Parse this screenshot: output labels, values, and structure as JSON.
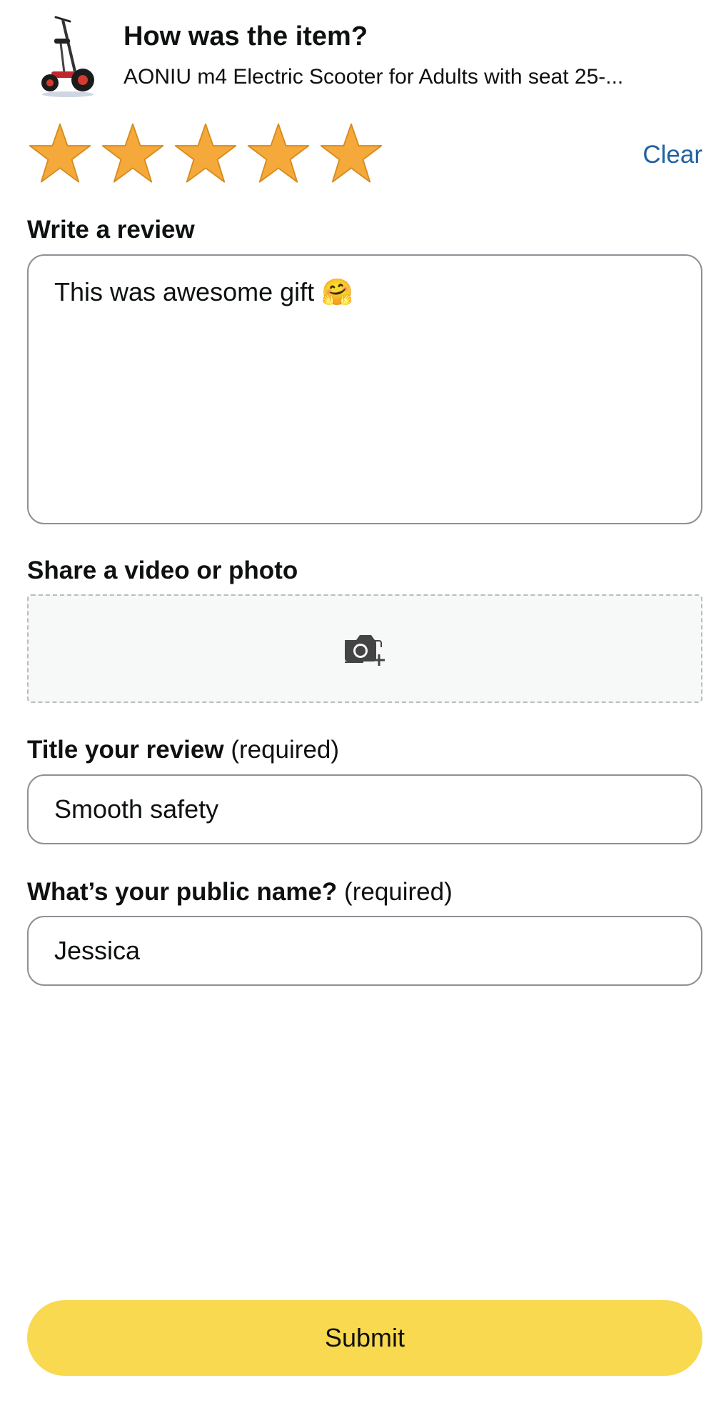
{
  "header": {
    "heading": "How was the item?",
    "product_title": "AONIU m4 Electric Scooter for Adults with seat 25-..."
  },
  "rating": {
    "stars_selected": 5,
    "stars_total": 5,
    "star_color": "#f5a93a",
    "clear_label": "Clear"
  },
  "review": {
    "label": "Write a review",
    "value": "This was awesome gift 🤗"
  },
  "media": {
    "label": "Share a video or photo",
    "icon": "camera-add-icon"
  },
  "title_field": {
    "label": "Title your review",
    "required_note": "(required)",
    "value": "Smooth safety"
  },
  "name_field": {
    "label": "What’s your public name?",
    "required_note": "(required)",
    "value": "Jessica"
  },
  "submit": {
    "label": "Submit",
    "color": "#f8d94f"
  },
  "colors": {
    "link": "#2162a1",
    "border": "#8d9096"
  }
}
